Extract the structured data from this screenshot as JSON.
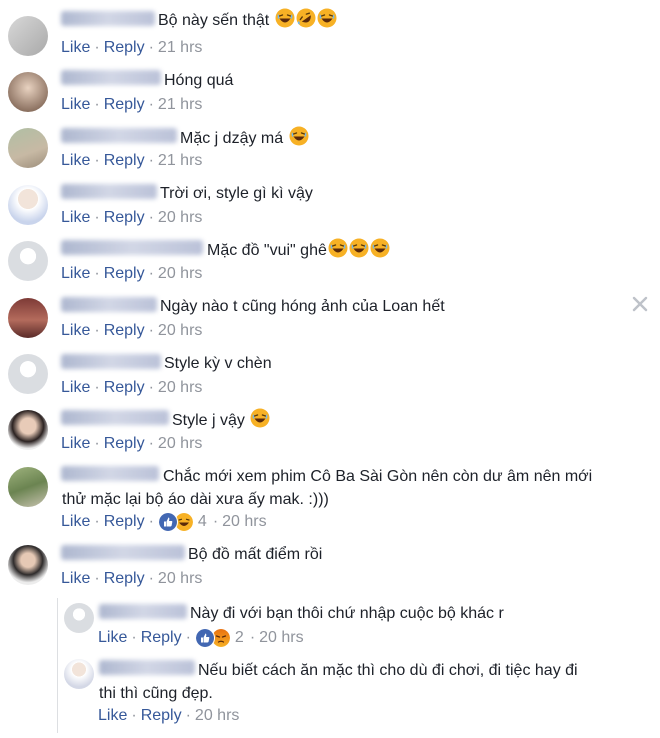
{
  "labels": {
    "like": "Like",
    "reply": "Reply"
  },
  "close_icon": "close-icon",
  "colors": {
    "link": "#365899",
    "meta": "#90949c",
    "text": "#1d2129",
    "like_blue": "#4267b2",
    "haha_yellow": "#f7b125"
  },
  "comments": [
    {
      "text": "Bộ này sến thật",
      "emoji": [
        "haha-emoji",
        "rofl-emoji",
        "haha-emoji"
      ],
      "time": "21 hrs"
    },
    {
      "text": "Hóng quá",
      "time": "21 hrs"
    },
    {
      "text": "Mặc j dzậy má",
      "emoji": [
        "haha-emoji"
      ],
      "time": "21 hrs"
    },
    {
      "text": "Trời ơi, style gì kì vậy",
      "time": "20 hrs"
    },
    {
      "text": "Mặc đồ \"vui\" ghê",
      "emoji": [
        "haha-emoji",
        "haha-emoji",
        "haha-emoji"
      ],
      "time": "20 hrs"
    },
    {
      "text": "Ngày nào t cũng hóng ảnh của Loan hết",
      "time": "20 hrs"
    },
    {
      "text": "Style kỳ v chèn",
      "time": "20 hrs"
    },
    {
      "text": "Style j vậy",
      "emoji": [
        "haha-emoji"
      ],
      "time": "20 hrs"
    },
    {
      "text": "Chắc mới xem phim Cô Ba Sài Gòn nên còn dư âm nên mới\nthử mặc lại bộ áo dài xưa ấy mak. :)))",
      "reactions": [
        "like",
        "haha"
      ],
      "reaction_count": "4",
      "time": "20 hrs"
    },
    {
      "text": "Bộ đồ mất điểm rồi",
      "time": "20 hrs"
    }
  ],
  "replies": [
    {
      "text": "Này đi với bạn thôi chứ nhập cuộc bộ khác r",
      "reactions": [
        "like",
        "angry"
      ],
      "reaction_count": "2",
      "time": "20 hrs"
    },
    {
      "text": "Nếu biết cách ăn mặc thì cho dù đi chơi, đi tiệc hay đi\nthi thì cũng đẹp.",
      "time": "20 hrs"
    }
  ]
}
